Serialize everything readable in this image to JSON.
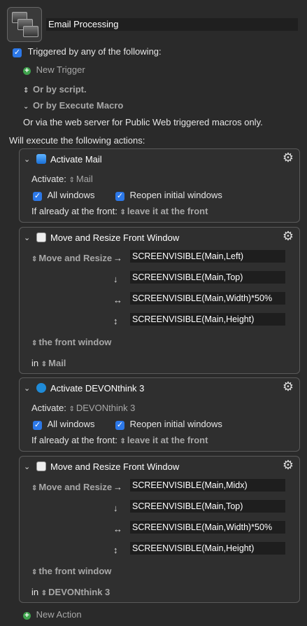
{
  "macro": {
    "name": "Email Processing"
  },
  "triggers": {
    "heading": "Triggered by any of the following:",
    "new_trigger": "New Trigger",
    "or_script": "Or by script.",
    "or_execute": "Or by Execute Macro",
    "web": "Or via the web server for Public Web triggered macros only."
  },
  "will_execute": "Will execute the following actions:",
  "actions": [
    {
      "title": "Activate Mail",
      "activate_label": "Activate:",
      "app": "Mail",
      "all_windows": "All windows",
      "reopen": "Reopen initial windows",
      "front_label": "If already at the front:",
      "front_value": "leave it at the front"
    },
    {
      "title": "Move and Resize Front Window",
      "mode": "Move and Resize",
      "fields": [
        "SCREENVISIBLE(Main,Left)",
        "SCREENVISIBLE(Main,Top)",
        "SCREENVISIBLE(Main,Width)*50%",
        "SCREENVISIBLE(Main,Height)"
      ],
      "target": "the front window",
      "in_label": "in",
      "app": "Mail"
    },
    {
      "title": "Activate DEVONthink 3",
      "activate_label": "Activate:",
      "app": "DEVONthink 3",
      "all_windows": "All windows",
      "reopen": "Reopen initial windows",
      "front_label": "If already at the front:",
      "front_value": "leave it at the front"
    },
    {
      "title": "Move and Resize Front Window",
      "mode": "Move and Resize",
      "fields": [
        "SCREENVISIBLE(Main,Midx)",
        "SCREENVISIBLE(Main,Top)",
        "SCREENVISIBLE(Main,Width)*50%",
        "SCREENVISIBLE(Main,Height)"
      ],
      "target": "the front window",
      "in_label": "in",
      "app": "DEVONthink 3"
    }
  ],
  "new_action": "New Action",
  "icons": {
    "arrows": [
      "→",
      "↓",
      "↔",
      "↕"
    ]
  }
}
